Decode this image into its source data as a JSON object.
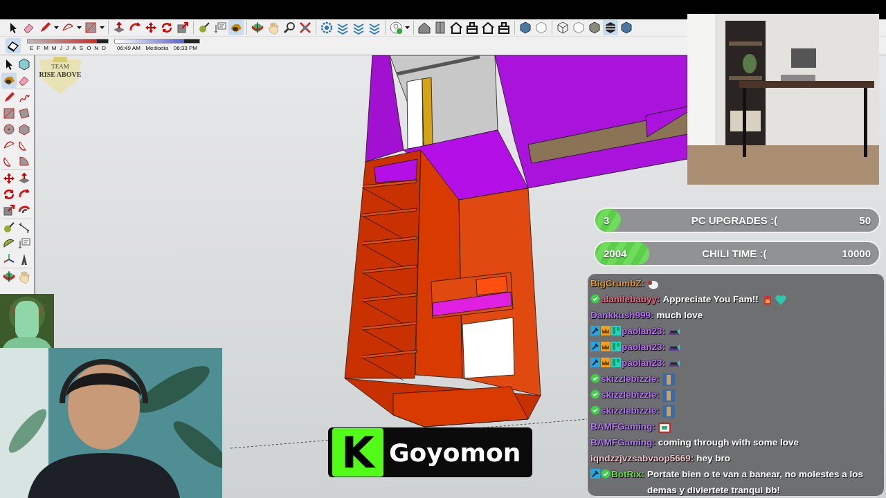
{
  "toolbar": {
    "time_bar": {
      "month_slider": {
        "level": 0.86
      },
      "months": [
        "E",
        "F",
        "M",
        "M",
        "J",
        "J",
        "A",
        "S",
        "O",
        "N",
        "D"
      ],
      "time_slider": {
        "level": 0.82
      },
      "sunrise": "06:49 AM",
      "noon": "Mediodía",
      "sunset": "06:33 PM"
    }
  },
  "logo": {
    "lines": [
      "TEAM",
      "RISE ABOVE"
    ]
  },
  "goals": [
    {
      "count": "3",
      "title": "PC UPGRADES :(",
      "target": "50",
      "level": 0.09
    },
    {
      "count": "2004",
      "title": "CHILI TIME :(",
      "target": "10000",
      "level": 0.19
    }
  ],
  "chat": {
    "messages": [
      {
        "user": "BigCrumbZ:",
        "color": "#e69a2c",
        "emotes": [
          {
            "kind": "sheep"
          }
        ]
      },
      {
        "badges": [
          {
            "kind": "verified"
          }
        ],
        "user": "alanilebabyy:",
        "color": "#ec6a86",
        "text": "Appreciate You Fam!!",
        "emotes": [
          {
            "kind": "creature"
          },
          {
            "kind": "heart"
          }
        ]
      },
      {
        "user": "Dankkush999:",
        "color": "#b374f2",
        "text": "much love"
      },
      {
        "badges": [
          {
            "kind": "mod"
          },
          {
            "kind": "vip"
          },
          {
            "kind": "og"
          }
        ],
        "user": "paolan23:",
        "color": "#bb6cf7",
        "emotes": [
          {
            "kind": "car"
          }
        ]
      },
      {
        "badges": [
          {
            "kind": "mod"
          },
          {
            "kind": "vip"
          },
          {
            "kind": "og"
          }
        ],
        "user": "paolan23:",
        "color": "#bb6cf7",
        "emotes": [
          {
            "kind": "car"
          }
        ]
      },
      {
        "badges": [
          {
            "kind": "mod"
          },
          {
            "kind": "vip"
          },
          {
            "kind": "og"
          }
        ],
        "user": "paolan23:",
        "color": "#bb6cf7",
        "emotes": [
          {
            "kind": "car"
          }
        ]
      },
      {
        "badges": [
          {
            "kind": "verified"
          }
        ],
        "user": "skizzlebizzle:",
        "color": "#b374f2",
        "emotes": [
          {
            "kind": "figure"
          }
        ]
      },
      {
        "badges": [
          {
            "kind": "verified"
          }
        ],
        "user": "skizzlebizzle:",
        "color": "#b374f2",
        "emotes": [
          {
            "kind": "figure"
          }
        ]
      },
      {
        "badges": [
          {
            "kind": "verified"
          }
        ],
        "user": "skizzlebizzle:",
        "color": "#b374f2",
        "emotes": [
          {
            "kind": "figure"
          }
        ]
      },
      {
        "user": "BAMFGaming:",
        "color": "#b37cf0",
        "emotes": [
          {
            "kind": "sign"
          }
        ]
      },
      {
        "user": "BAMFGaming:",
        "color": "#b37cf0",
        "text": "coming through with some love"
      },
      {
        "user": "iqndzzjvzsabvaop5669:",
        "color": "#f0c4cc",
        "text": "hey bro"
      },
      {
        "badges": [
          {
            "kind": "mod"
          },
          {
            "kind": "verified"
          }
        ],
        "user": "BotRix:",
        "color": "#6ee04a",
        "text": "Portate bien o te van a banear, no molestes a los demas y diviertete tranqui bb!"
      }
    ]
  },
  "streamer": {
    "logo_letter": "K",
    "name": "Goyomon"
  }
}
